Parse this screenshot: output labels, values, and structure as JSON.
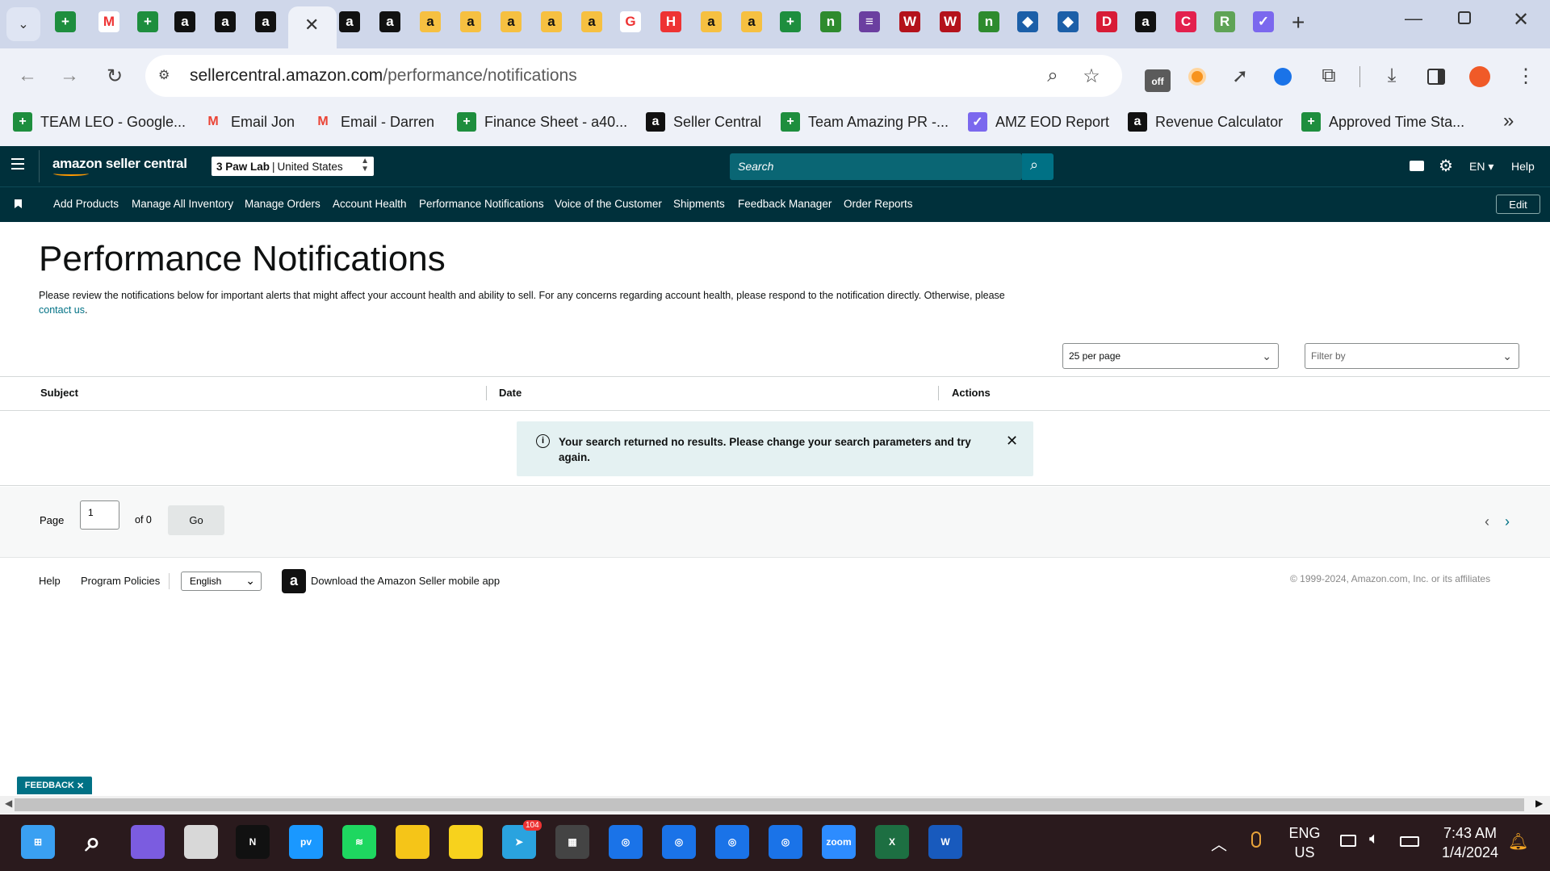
{
  "browser": {
    "url_host": "sellercentral.amazon.com",
    "url_path": "/performance/notifications",
    "bookmarks": [
      {
        "label": "TEAM LEO - Google...",
        "icon": "sheets-icon",
        "color": "#1e8e3e"
      },
      {
        "label": "Email Jon",
        "icon": "gmail-icon",
        "color": "#ea4335"
      },
      {
        "label": "Email - Darren",
        "icon": "gmail-icon",
        "color": "#ea4335"
      },
      {
        "label": "Finance Sheet - a40...",
        "icon": "sheets-icon",
        "color": "#1e8e3e"
      },
      {
        "label": "Seller Central",
        "icon": "amazon-icon",
        "color": "#111111"
      },
      {
        "label": "Team Amazing PR -...",
        "icon": "sheets-icon",
        "color": "#1e8e3e"
      },
      {
        "label": "AMZ EOD Report",
        "icon": "clickup-icon",
        "color": "#7b68ee"
      },
      {
        "label": "Revenue Calculator",
        "icon": "amazon-icon",
        "color": "#111111"
      },
      {
        "label": "Approved Time Sta...",
        "icon": "sheets-icon",
        "color": "#1e8e3e"
      }
    ],
    "bookmarks_overflow": "»",
    "extension_badge": "off"
  },
  "seller_central": {
    "logo": "amazon seller central",
    "store": "3 Paw Lab",
    "marketplace": "United States",
    "search_placeholder": "Search",
    "language": "EN",
    "help": "Help",
    "nav": [
      "Add Products",
      "Manage All Inventory",
      "Manage Orders",
      "Account Health",
      "Performance Notifications",
      "Voice of the Customer",
      "Shipments",
      "Feedback Manager",
      "Order Reports"
    ],
    "edit_label": "Edit"
  },
  "page": {
    "title": "Performance Notifications",
    "description": "Please review the notifications below for important alerts that might affect your account health and ability to sell. For any concerns regarding account health, please respond to the notification directly. Otherwise, please",
    "contact_link": "contact us",
    "per_page": "25 per page",
    "filter_placeholder": "Filter by",
    "columns": [
      "Subject",
      "Date",
      "Actions"
    ],
    "no_results": "Your search returned no results. Please change your search parameters and try again.",
    "pager": {
      "label": "Page",
      "current": "1",
      "of": "of 0",
      "go": "Go"
    }
  },
  "footer": {
    "help": "Help",
    "policies": "Program Policies",
    "language": "English",
    "app_text": "Download the Amazon Seller mobile app",
    "copyright": "© 1999-2024, Amazon.com, Inc. or its affiliates",
    "feedback": "FEEDBACK"
  },
  "taskbar": {
    "language_line1": "ENG",
    "language_line2": "US",
    "time": "7:43 AM",
    "date": "1/4/2024",
    "telegram_badge": "104"
  },
  "colors": {
    "amazon_dark": "#00303b",
    "link": "#007185",
    "alert_bg": "#e4f1f2"
  }
}
